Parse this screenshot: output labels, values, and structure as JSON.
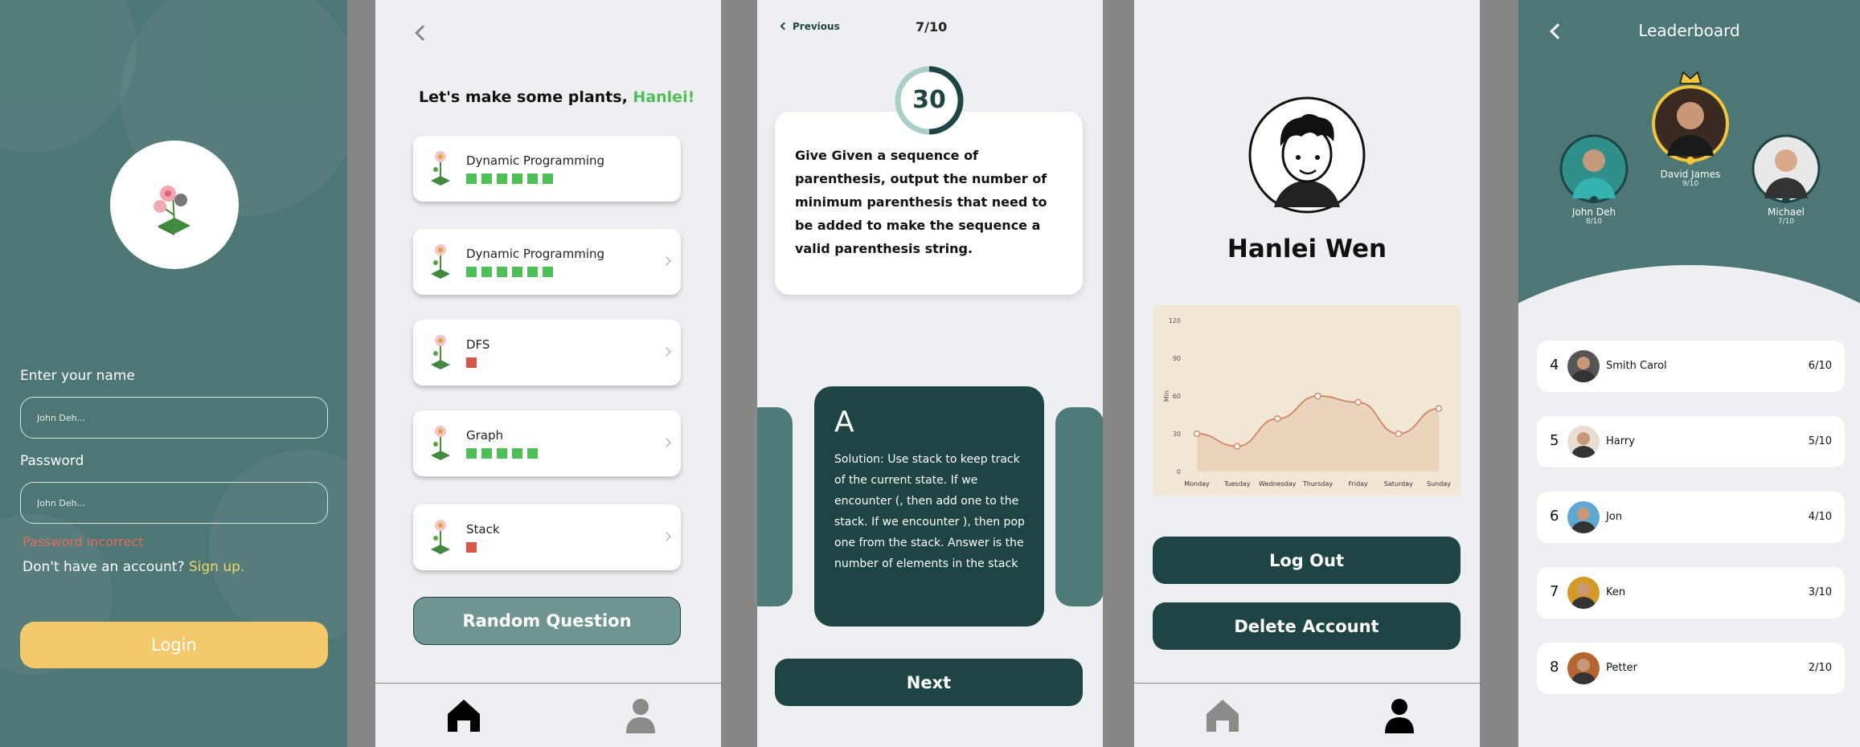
{
  "login": {
    "name_label": "Enter your name",
    "name_placeholder": "John Deh...",
    "password_label": "Password",
    "password_placeholder": "John Deh...",
    "error_text": "Password incorrect",
    "signup_prompt": "Don't have an account?",
    "signup_link": "Sign up.",
    "login_button": "Login"
  },
  "home": {
    "greeting": "Let's make some plants,",
    "user_name": "Hanlei!",
    "topics": [
      {
        "title": "Dynamic Programming",
        "progress": 6,
        "status": "green"
      },
      {
        "title": "Dynamic Programming",
        "progress": 6,
        "status": "green"
      },
      {
        "title": "DFS",
        "progress": 1,
        "status": "red"
      },
      {
        "title": "Graph",
        "progress": 5,
        "status": "green"
      },
      {
        "title": "Stack",
        "progress": 1,
        "status": "red"
      }
    ],
    "random_button": "Random Question"
  },
  "question": {
    "previous_label": "Previous",
    "counter": "7/10",
    "timer": "30",
    "text": "Give Given a sequence of parenthesis, output the number of minimum parenthesis that need to be added to make the sequence a valid parenthesis string.",
    "answer_letter": "A",
    "answer_text": "Solution: Use stack to keep track of the current state. If we encounter (, then add one to the stack. If we encounter ), then pop one from the stack. Answer is the number of elements in the stack",
    "next_button": "Next"
  },
  "profile": {
    "name": "Hanlei Wen",
    "logout_button": "Log Out",
    "delete_button": "Delete Account"
  },
  "chart_data": {
    "type": "area",
    "categories": [
      "Monday",
      "Tuesday",
      "Wednesday",
      "Thursday",
      "Friday",
      "Saturday",
      "Sunday"
    ],
    "values": [
      30,
      20,
      42,
      60,
      55,
      30,
      50
    ],
    "ylabel": "Min",
    "ylim": [
      0,
      120
    ],
    "yticks": [
      0,
      30,
      60,
      90,
      120
    ],
    "line_color": "#d48a6a",
    "fill_color": "#ead2bb"
  },
  "leaderboard": {
    "title": "Leaderboard",
    "podium": [
      {
        "name": "John Deh",
        "score": "8/10",
        "rank": "2"
      },
      {
        "name": "David James",
        "score": "9/10",
        "rank": "1"
      },
      {
        "name": "Michael",
        "score": "7/10",
        "rank": "3"
      }
    ],
    "rows": [
      {
        "rank": "4",
        "name": "Smith Carol",
        "score": "6/10"
      },
      {
        "rank": "5",
        "name": "Harry",
        "score": "5/10"
      },
      {
        "rank": "6",
        "name": "Jon",
        "score": "4/10"
      },
      {
        "rank": "7",
        "name": "Ken",
        "score": "3/10"
      },
      {
        "rank": "8",
        "name": "Petter",
        "score": "2/10"
      }
    ]
  },
  "colors": {
    "teal": "#4d7774",
    "dark": "#1e4543",
    "green": "#4fbf58",
    "yellow": "#f3c96c",
    "error": "#e36b5b"
  }
}
